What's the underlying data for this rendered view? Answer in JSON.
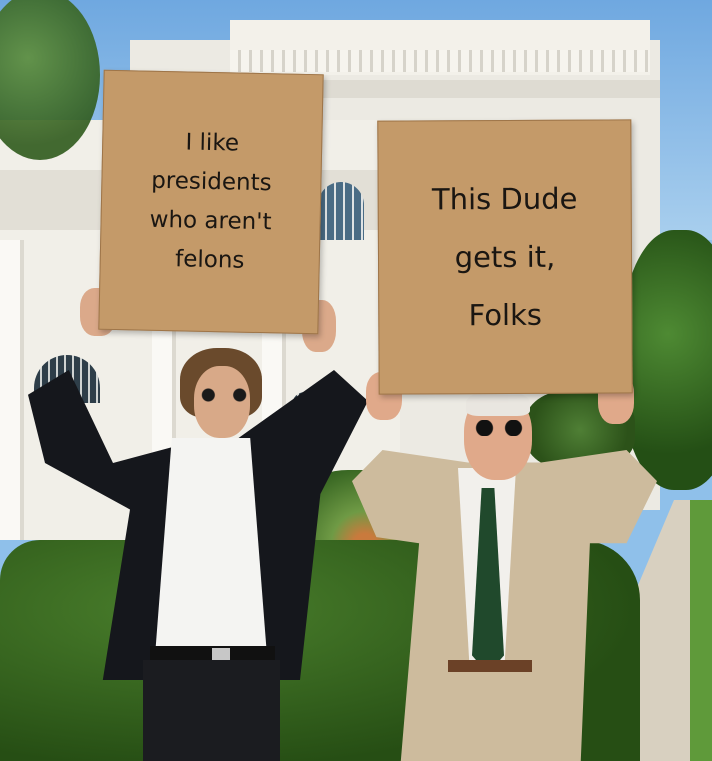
{
  "photo": {
    "left_sign": {
      "lines": [
        "I like",
        "presidents",
        "who aren't",
        "felons"
      ]
    },
    "right_sign": {
      "lines": [
        "This Dude",
        "gets it,",
        "Folks"
      ]
    }
  }
}
